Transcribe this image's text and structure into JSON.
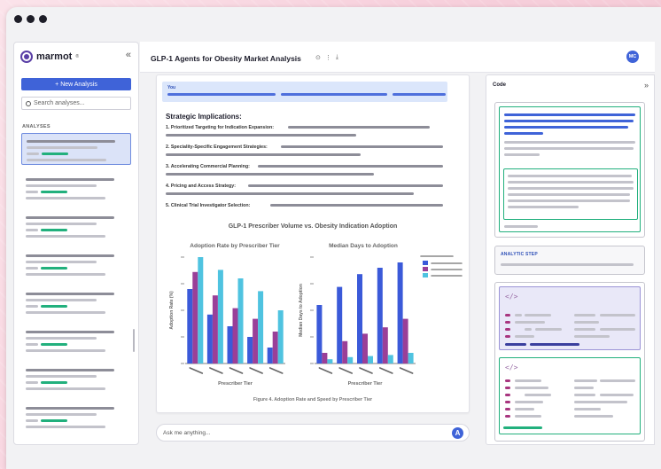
{
  "window": {
    "app_name": "marmot",
    "brand_mark": "®"
  },
  "sidebar": {
    "collapse_icon": "«",
    "new_button": "+ New Analysis",
    "search_placeholder": "Search analyses...",
    "section_label": "ANALYSES"
  },
  "header": {
    "title": "GLP-1 Agents for Obesity Market Analysis",
    "info_icon": "⊙",
    "more_icon": "⋮",
    "download_icon": "⤓",
    "avatar": "MC"
  },
  "chat": {
    "you_label": "You",
    "heading": "Strategic Implications:",
    "items": [
      "1. Prioritized Targeting for Indication Expansion:",
      "2. Speciality-Specific Engagement Strategies:",
      "3. Accelerating Commercial Planning:",
      "4. Pricing and Access Strategy:",
      "5. Clinical Trial Investigator Selection:"
    ],
    "caption": "Figure 4. Adoption Rate and Speed by Prescriber Tier"
  },
  "chart_data": {
    "type": "bar",
    "title": "GLP-1 Prescriber Volume vs. Obesity Indication Adoption",
    "series_colors": [
      "#3b5ad9",
      "#9a3f98",
      "#4fc3e0"
    ],
    "subplots": [
      {
        "title": "Adoption Rate by Prescriber Tier",
        "xlabel": "Prescriber Tier",
        "ylabel": "Adoption Rate (%)",
        "ylim": [
          0,
          100
        ],
        "series": [
          {
            "values": [
              70,
              46,
              35,
              25,
              15
            ]
          },
          {
            "values": [
              86,
              64,
              52,
              42,
              30
            ]
          },
          {
            "values": [
              100,
              88,
              80,
              68,
              50
            ]
          }
        ]
      },
      {
        "title": "Median Days to Adoption",
        "xlabel": "Prescriber Tier",
        "ylabel": "Median Days to Adoption",
        "ylim": [
          0,
          100
        ],
        "series": [
          {
            "values": [
              55,
              72,
              84,
              90,
              95
            ]
          },
          {
            "values": [
              10,
              21,
              28,
              34,
              42
            ]
          },
          {
            "values": [
              4,
              6,
              7,
              8,
              10
            ]
          }
        ]
      }
    ]
  },
  "input": {
    "placeholder": "Ask me anything...",
    "send_icon": "A"
  },
  "code_panel": {
    "label": "Code",
    "expand_icon": "»",
    "step_label": "ANALYTIC STEP",
    "code_icon": "</>"
  }
}
